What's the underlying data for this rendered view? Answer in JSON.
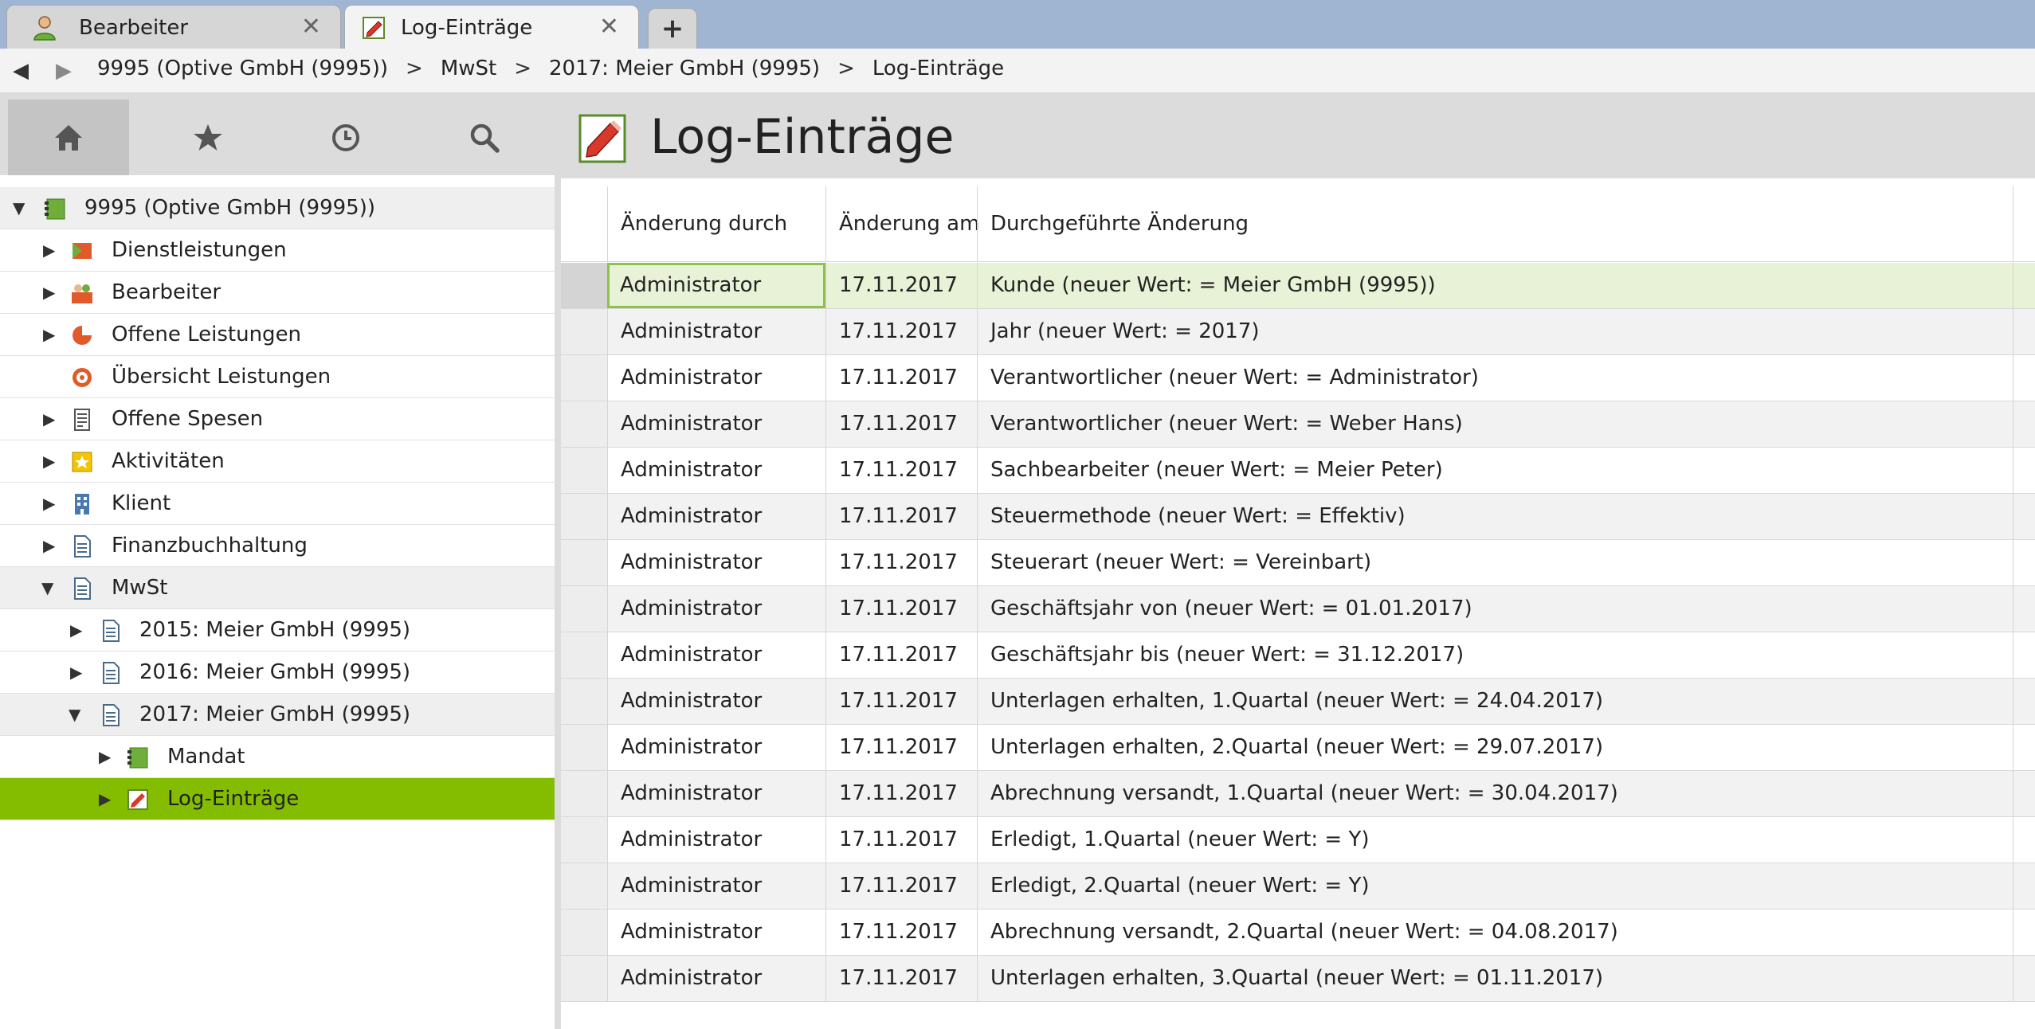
{
  "tabs": [
    {
      "label": "Bearbeiter",
      "close": "✕"
    },
    {
      "label": "Log-Einträge",
      "close": "✕"
    }
  ],
  "new_tab_label": "+",
  "breadcrumb": {
    "back": "◀",
    "forward": "▶",
    "items": [
      "9995 (Optive GmbH (9995))",
      "MwSt",
      "2017: Meier GmbH (9995)",
      "Log-Einträge"
    ],
    "separator": ">"
  },
  "left_toolbar": [
    "home-icon",
    "star-icon",
    "clock-icon",
    "search-icon"
  ],
  "tree": [
    {
      "label": "9995 (Optive GmbH (9995))",
      "expanded": true,
      "icon": "mandant-icon"
    },
    {
      "label": "Dienstleistungen",
      "icon": "services-icon"
    },
    {
      "label": "Bearbeiter",
      "icon": "users-icon"
    },
    {
      "label": "Offene Leistungen",
      "icon": "pie-icon"
    },
    {
      "label": "Übersicht Leistungen",
      "icon": "target-icon"
    },
    {
      "label": "Offene Spesen",
      "icon": "receipt-icon"
    },
    {
      "label": "Aktivitäten",
      "icon": "star-badge-icon"
    },
    {
      "label": "Klient",
      "icon": "building-icon"
    },
    {
      "label": "Finanzbuchhaltung",
      "icon": "document-icon"
    },
    {
      "label": "MwSt",
      "icon": "document-icon",
      "expanded": true
    },
    {
      "label": "2015: Meier GmbH (9995)",
      "icon": "document-icon"
    },
    {
      "label": "2016: Meier GmbH (9995)",
      "icon": "document-icon"
    },
    {
      "label": "2017: Meier GmbH (9995)",
      "icon": "document-icon",
      "expanded": true
    },
    {
      "label": "Mandat",
      "icon": "mandat-icon"
    },
    {
      "label": "Log-Einträge",
      "icon": "log-edit-icon",
      "selected": true
    }
  ],
  "main": {
    "title": "Log-Einträge",
    "columns": [
      "Änderung durch",
      "Änderung am",
      "Durchgeführte Änderung"
    ],
    "rows": [
      [
        "Administrator",
        "17.11.2017",
        "Kunde (neuer Wert: = Meier GmbH (9995))"
      ],
      [
        "Administrator",
        "17.11.2017",
        "Jahr (neuer Wert: = 2017)"
      ],
      [
        "Administrator",
        "17.11.2017",
        "Verantwortlicher (neuer Wert: = Administrator)"
      ],
      [
        "Administrator",
        "17.11.2017",
        "Verantwortlicher (neuer Wert: = Weber Hans)"
      ],
      [
        "Administrator",
        "17.11.2017",
        "Sachbearbeiter (neuer Wert: = Meier Peter)"
      ],
      [
        "Administrator",
        "17.11.2017",
        "Steuermethode (neuer Wert: = Effektiv)"
      ],
      [
        "Administrator",
        "17.11.2017",
        "Steuerart (neuer Wert: = Vereinbart)"
      ],
      [
        "Administrator",
        "17.11.2017",
        "Geschäftsjahr von (neuer Wert: = 01.01.2017)"
      ],
      [
        "Administrator",
        "17.11.2017",
        "Geschäftsjahr bis (neuer Wert: = 31.12.2017)"
      ],
      [
        "Administrator",
        "17.11.2017",
        "Unterlagen erhalten, 1.Quartal (neuer Wert: = 24.04.2017)"
      ],
      [
        "Administrator",
        "17.11.2017",
        "Unterlagen erhalten, 2.Quartal (neuer Wert: = 29.07.2017)"
      ],
      [
        "Administrator",
        "17.11.2017",
        "Abrechnung versandt, 1.Quartal (neuer Wert: = 30.04.2017)"
      ],
      [
        "Administrator",
        "17.11.2017",
        "Erledigt, 1.Quartal (neuer Wert: = Y)"
      ],
      [
        "Administrator",
        "17.11.2017",
        "Erledigt, 2.Quartal (neuer Wert: = Y)"
      ],
      [
        "Administrator",
        "17.11.2017",
        "Abrechnung versandt, 2.Quartal (neuer Wert: = 04.08.2017)"
      ],
      [
        "Administrator",
        "17.11.2017",
        "Unterlagen erhalten, 3.Quartal (neuer Wert: = 01.11.2017)"
      ]
    ]
  },
  "colors": {
    "tabbar": "#9fb5d2",
    "selection_green": "#84bd00",
    "selected_row": "#e8f2d6",
    "focus_border": "#8cc14c"
  }
}
